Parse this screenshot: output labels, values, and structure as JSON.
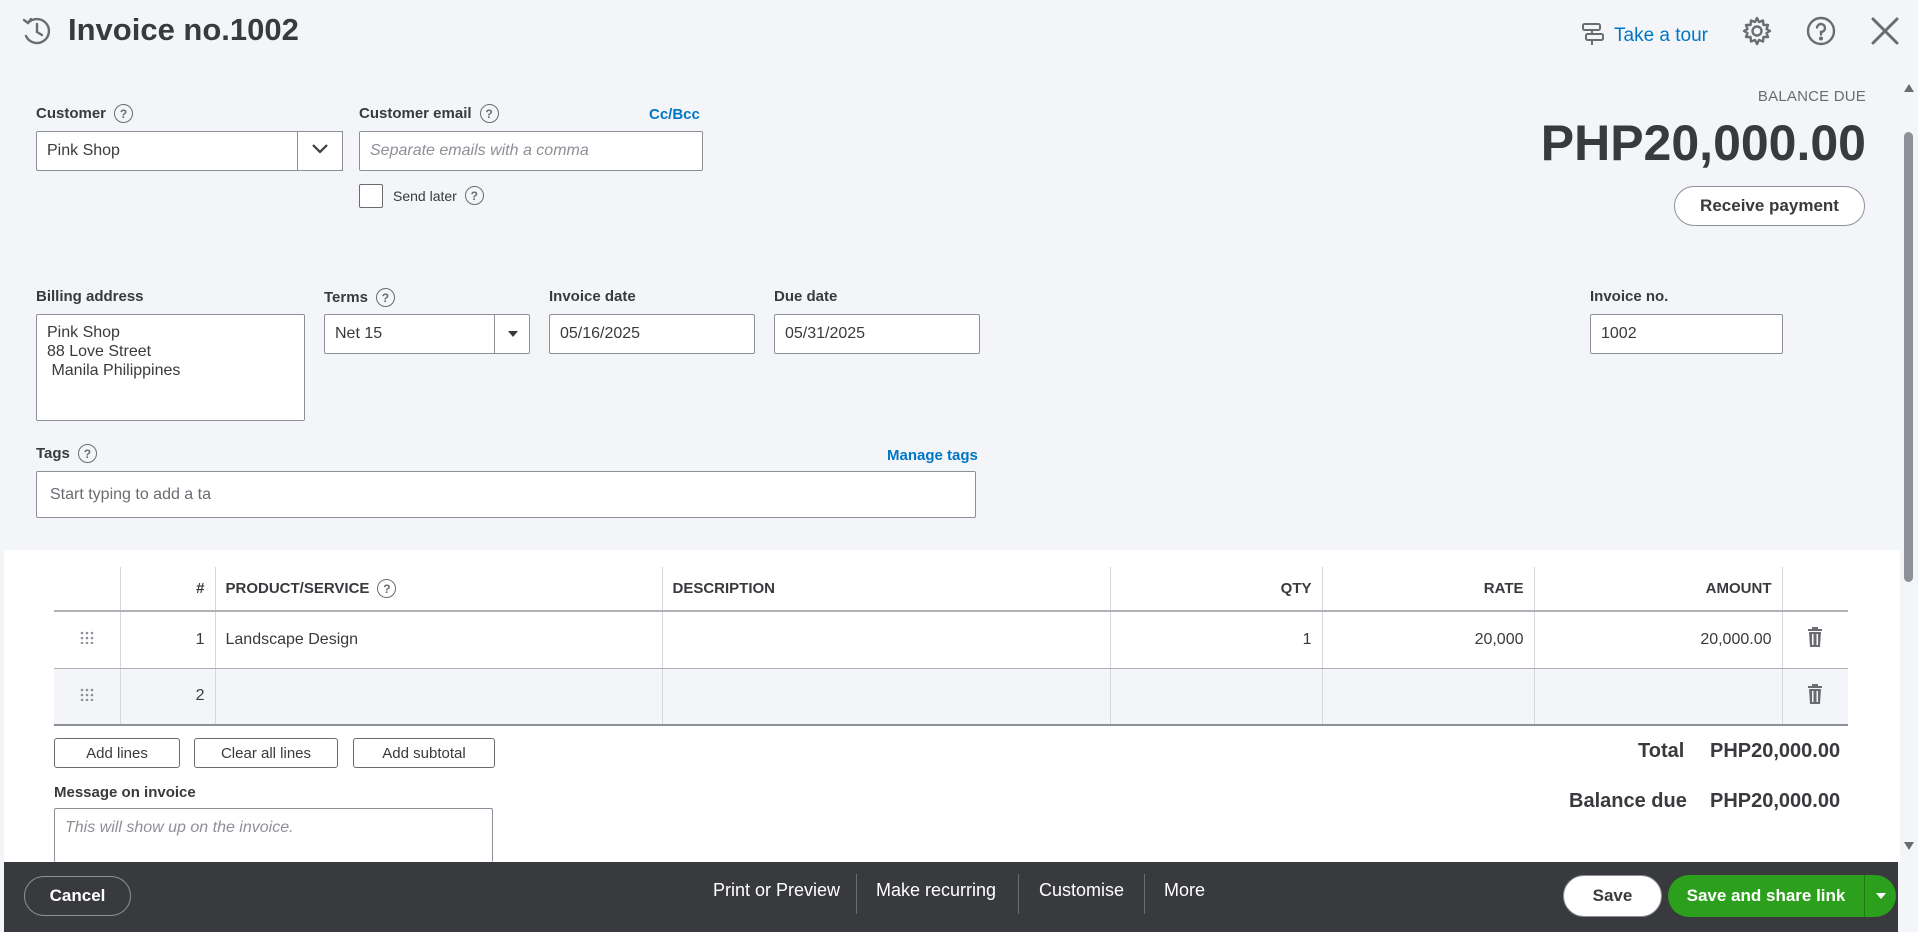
{
  "header": {
    "title": "Invoice no.1002",
    "tour_label": "Take a tour"
  },
  "customer": {
    "label": "Customer",
    "value": "Pink Shop"
  },
  "customer_email": {
    "label": "Customer email",
    "placeholder": "Separate emails with a comma",
    "cc_bcc": "Cc/Bcc",
    "send_later": "Send later"
  },
  "balance": {
    "label": "BALANCE DUE",
    "amount": "PHP20,000.00",
    "receive_payment": "Receive payment"
  },
  "billing": {
    "label": "Billing address",
    "line1": "Pink Shop",
    "line2": "88 Love Street",
    "line3": " Manila Philippines"
  },
  "terms": {
    "label": "Terms",
    "value": "Net 15"
  },
  "invoice_date": {
    "label": "Invoice date",
    "value": "05/16/2025"
  },
  "due_date": {
    "label": "Due date",
    "value": "05/31/2025"
  },
  "invoice_no": {
    "label": "Invoice no.",
    "value": "1002"
  },
  "tags": {
    "label": "Tags",
    "manage": "Manage tags",
    "input_value": "Start typing to add a ta"
  },
  "table": {
    "headers": {
      "num": "#",
      "product": "PRODUCT/SERVICE",
      "description": "DESCRIPTION",
      "qty": "QTY",
      "rate": "RATE",
      "amount": "AMOUNT"
    },
    "rows": [
      {
        "num": "1",
        "product": "Landscape Design",
        "description": "",
        "qty": "1",
        "rate": "20,000",
        "amount": "20,000.00"
      },
      {
        "num": "2",
        "product": "",
        "description": "",
        "qty": "",
        "rate": "",
        "amount": ""
      }
    ]
  },
  "line_actions": {
    "add_lines": "Add lines",
    "clear_all": "Clear all lines",
    "add_subtotal": "Add subtotal"
  },
  "message": {
    "label": "Message on invoice",
    "placeholder": "This will show up on the invoice."
  },
  "totals": {
    "total_label": "Total",
    "total_value": "PHP20,000.00",
    "balance_label": "Balance due",
    "balance_value": "PHP20,000.00"
  },
  "footer": {
    "cancel": "Cancel",
    "print_preview": "Print or Preview",
    "make_recurring": "Make recurring",
    "customise": "Customise",
    "more": "More",
    "save": "Save",
    "save_share": "Save and share link"
  },
  "colors": {
    "link": "#0077c5",
    "primary_green": "#2ca01c",
    "footer_bg": "#393a3d"
  }
}
